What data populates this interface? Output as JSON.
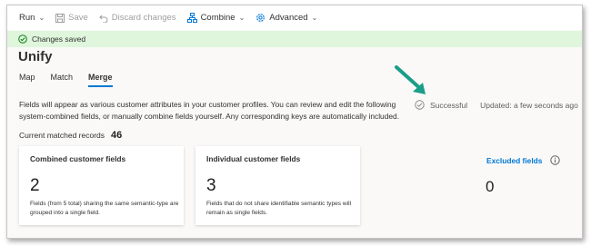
{
  "toolbar": {
    "run_label": "Run",
    "save_label": "Save",
    "discard_label": "Discard changes",
    "combine_label": "Combine",
    "advanced_label": "Advanced"
  },
  "banner": {
    "message": "Changes saved"
  },
  "page": {
    "title": "Unify"
  },
  "tabs": [
    {
      "label": "Map"
    },
    {
      "label": "Match"
    },
    {
      "label": "Merge",
      "active": true
    }
  ],
  "description": "Fields will appear as various customer attributes in your customer profiles. You can review and edit the following system-combined fields, or manually combine fields yourself. Any corresponding keys are automatically included.",
  "status": {
    "label": "Successful",
    "updated": "Updated: a few seconds ago"
  },
  "records": {
    "label": "Current matched records",
    "count": "46"
  },
  "cards": [
    {
      "title": "Combined customer fields",
      "value": "2",
      "description": "Fields (from 5 total) sharing the same semantic-type are grouped into a single field."
    },
    {
      "title": "Individual customer fields",
      "value": "3",
      "description": "Fields that do not share identifiable semantic types will remain as single fields."
    }
  ],
  "excluded": {
    "label": "Excluded fields",
    "value": "0"
  },
  "colors": {
    "accent": "#0078d4",
    "success_banner": "#dff6dd",
    "success_icon": "#107c10",
    "annotation_arrow": "#1a9e8a"
  }
}
